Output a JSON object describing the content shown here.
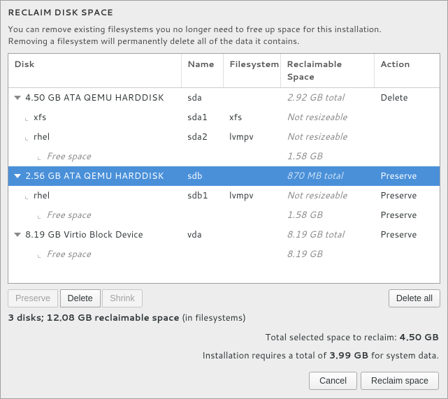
{
  "title": "RECLAIM DISK SPACE",
  "desc1": "You can remove existing filesystems you no longer need to free up space for this installation.",
  "desc2": "Removing a filesystem will permanently delete all of the data it contains.",
  "columns": {
    "disk": "Disk",
    "name": "Name",
    "fs": "Filesystem",
    "recl": "Reclaimable Space",
    "action": "Action"
  },
  "rows": [
    {
      "type": "disk",
      "disk": "4.50 GB ATA QEMU HARDDISK",
      "name": "sda",
      "fs": "",
      "recl": "2.92 GB total",
      "recl_muted": true,
      "action": "Delete",
      "selected": false
    },
    {
      "type": "part",
      "disk": "xfs",
      "name": "sda1",
      "fs": "xfs",
      "recl": "Not resizeable",
      "recl_muted": true,
      "action": "",
      "selected": false
    },
    {
      "type": "part",
      "disk": "rhel",
      "name": "sda2",
      "fs": "lvmpv",
      "recl": "Not resizeable",
      "recl_muted": true,
      "action": "",
      "selected": false
    },
    {
      "type": "free",
      "disk": "Free space",
      "name": "",
      "fs": "",
      "recl": "1.58 GB",
      "recl_muted": true,
      "action": "",
      "selected": false
    },
    {
      "type": "disk",
      "disk": "2.56 GB ATA QEMU HARDDISK",
      "name": "sdb",
      "fs": "",
      "recl": "870 MB total",
      "recl_muted": true,
      "action": "Preserve",
      "selected": true
    },
    {
      "type": "part",
      "disk": "rhel",
      "name": "sdb1",
      "fs": "lvmpv",
      "recl": "Not resizeable",
      "recl_muted": true,
      "action": "Preserve",
      "selected": false
    },
    {
      "type": "free",
      "disk": "Free space",
      "name": "",
      "fs": "",
      "recl": "1.58 GB",
      "recl_muted": true,
      "action": "Preserve",
      "selected": false
    },
    {
      "type": "disk",
      "disk": "8.19 GB Virtio Block Device",
      "name": "vda",
      "fs": "",
      "recl": "8.19 GB total",
      "recl_muted": true,
      "action": "Preserve",
      "selected": false
    },
    {
      "type": "free",
      "disk": "Free space",
      "name": "",
      "fs": "",
      "recl": "8.19 GB",
      "recl_muted": true,
      "action": "",
      "selected": false
    }
  ],
  "buttons": {
    "preserve": "Preserve",
    "delete": "Delete",
    "shrink": "Shrink",
    "delete_all": "Delete all",
    "cancel": "Cancel",
    "reclaim": "Reclaim space"
  },
  "summary": {
    "bold": "3 disks; 12.08 GB reclaimable space",
    "rest": " (in filesystems)"
  },
  "total_line": {
    "pre": "Total selected space to reclaim: ",
    "bold": "4.50 GB"
  },
  "install_line": {
    "pre": "Installation requires a total of ",
    "bold": "3.99 GB",
    "post": " for system data."
  }
}
